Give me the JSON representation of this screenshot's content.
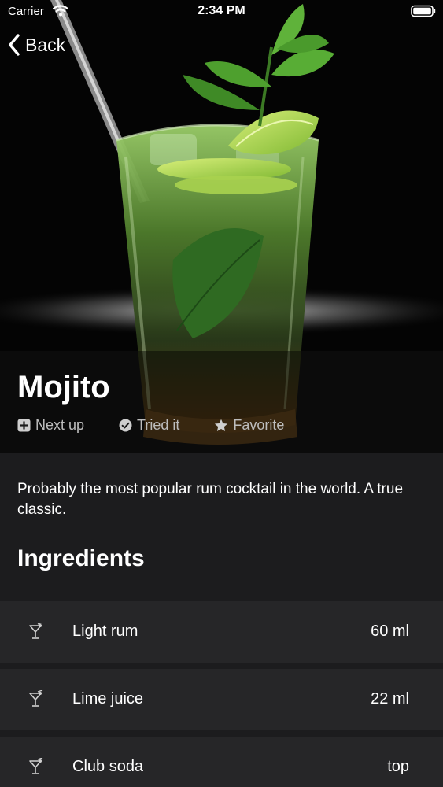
{
  "status_bar": {
    "carrier": "Carrier",
    "time": "2:34 PM"
  },
  "nav": {
    "back_label": "Back"
  },
  "drink": {
    "name": "Mojito",
    "actions": [
      {
        "icon": "plus-square-icon",
        "label": "Next up"
      },
      {
        "icon": "check-circle-icon",
        "label": "Tried it"
      },
      {
        "icon": "star-icon",
        "label": "Favorite"
      }
    ],
    "description": "Probably the most popular rum cocktail in the world. A true classic."
  },
  "ingredients_section": {
    "title": "Ingredients",
    "items": [
      {
        "icon": "cocktail-glass-icon",
        "name": "Light rum",
        "amount": "60 ml"
      },
      {
        "icon": "cocktail-glass-icon",
        "name": "Lime juice",
        "amount": "22 ml"
      },
      {
        "icon": "cocktail-glass-icon",
        "name": "Club soda",
        "amount": "top"
      }
    ]
  }
}
